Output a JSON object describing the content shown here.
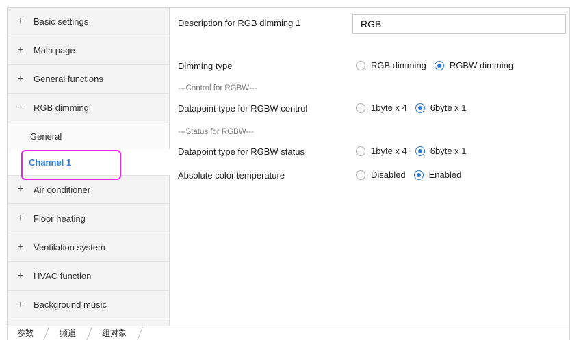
{
  "sidebar": {
    "items": [
      {
        "sign": "+",
        "label": "Basic settings"
      },
      {
        "sign": "+",
        "label": "Main page"
      },
      {
        "sign": "+",
        "label": "General functions"
      },
      {
        "sign": "−",
        "label": "RGB dimming"
      },
      {
        "sign": "+",
        "label": "Air conditioner"
      },
      {
        "sign": "+",
        "label": "Floor heating"
      },
      {
        "sign": "+",
        "label": "Ventilation system"
      },
      {
        "sign": "+",
        "label": "HVAC function"
      },
      {
        "sign": "+",
        "label": "Background music"
      }
    ],
    "subitems": [
      {
        "label": "General"
      },
      {
        "label": "Channel 1"
      }
    ]
  },
  "main": {
    "description": {
      "label": "Description for RGB dimming 1",
      "value": "RGB"
    },
    "dimming_type": {
      "label": "Dimming type",
      "options": [
        "RGB dimming",
        "RGBW dimming"
      ],
      "selected": "RGBW dimming"
    },
    "control_section": "---Control for RGBW---",
    "control_dpt": {
      "label": "Datapoint type for RGBW control",
      "options": [
        "1byte x 4",
        "6byte x 1"
      ],
      "selected": "6byte x 1"
    },
    "status_section": "---Status for RGBW---",
    "status_dpt": {
      "label": "Datapoint type for RGBW status",
      "options": [
        "1byte x 4",
        "6byte x 1"
      ],
      "selected": "6byte x 1"
    },
    "color_temp": {
      "label": "Absolute color temperature",
      "options": [
        "Disabled",
        "Enabled"
      ],
      "selected": "Enabled"
    }
  },
  "tabs": [
    "参数",
    "频道",
    "组对象"
  ],
  "colors": {
    "accent": "#2e7bd8",
    "highlight": "#ee22ee"
  }
}
